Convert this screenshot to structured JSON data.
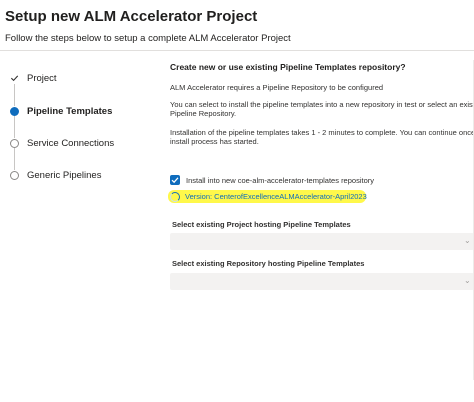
{
  "header": {
    "title": "Setup new ALM Accelerator Project",
    "subtitle": "Follow the steps below to setup a complete ALM Accelerator Project"
  },
  "steps": [
    {
      "label": "Project",
      "state": "done"
    },
    {
      "label": "Pipeline Templates",
      "state": "active"
    },
    {
      "label": "Service Connections",
      "state": "todo"
    },
    {
      "label": "Generic Pipelines",
      "state": "todo"
    }
  ],
  "content": {
    "heading": "Create new or use existing Pipeline Templates repository?",
    "p1": "ALM Accelerator requires a Pipeline Repository to be configured",
    "p2_line1": "You can select to install the pipeline templates into a new repository in test or select an existing",
    "p2_line2": "Pipeline Repository.",
    "p3_line1": "Installation of the pipeline templates takes 1 - 2 minutes to complete. You can continue once the",
    "p3_line2": "install process has started.",
    "checkbox_label": "Install into new coe-alm-accelerator-templates repository",
    "checkbox_checked": true,
    "version_text": "Version: CenterofExcellenceALMAccelerator-April2023",
    "project_label": "Select existing Project hosting Pipeline Templates",
    "repo_label": "Select existing Repository hosting Pipeline Templates"
  },
  "colors": {
    "accent": "#0f6cbd",
    "highlight": "#fff84a"
  }
}
